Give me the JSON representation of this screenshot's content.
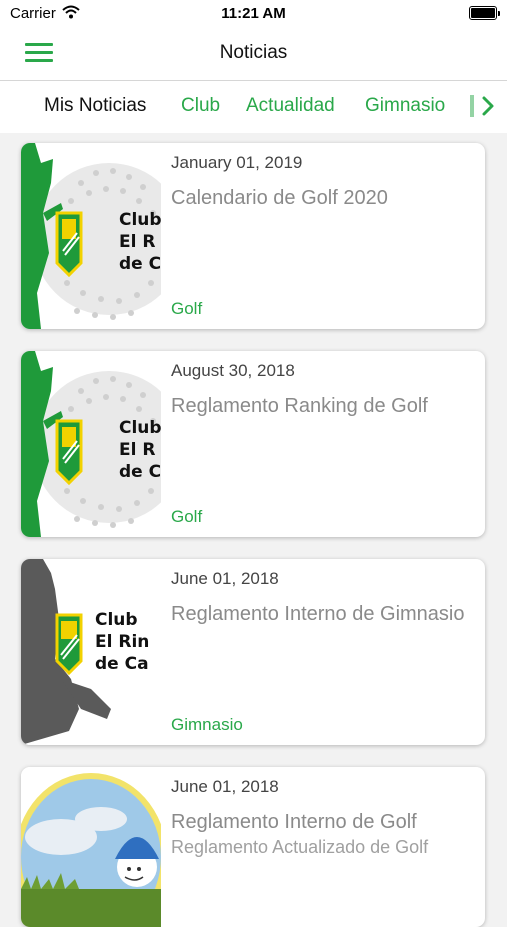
{
  "status_bar": {
    "carrier": "Carrier",
    "time": "11:21 AM"
  },
  "navbar": {
    "title": "Noticias"
  },
  "tabs": [
    {
      "label": "Mis Noticias",
      "active": true
    },
    {
      "label": "Club",
      "active": false
    },
    {
      "label": "Actualidad",
      "active": false
    },
    {
      "label": "Gimnasio",
      "active": false
    }
  ],
  "logo": {
    "line1": "Club",
    "line2": "El R",
    "line3": "de C",
    "line2_alt": "El Rin",
    "line3_alt": "de Ca"
  },
  "news": [
    {
      "date": "January 01, 2019",
      "title": "Calendario de Golf 2020",
      "subtitle": "",
      "category": "Golf"
    },
    {
      "date": "August 30, 2018",
      "title": "Reglamento Ranking de Golf",
      "subtitle": "",
      "category": "Golf"
    },
    {
      "date": "June 01, 2018",
      "title": "Reglamento Interno de Gimnasio",
      "subtitle": "",
      "category": "Gimnasio"
    },
    {
      "date": "June 01, 2018",
      "title": "Reglamento Interno de Golf",
      "subtitle": "Reglamento Actualizado de Golf",
      "category": ""
    }
  ],
  "colors": {
    "accent": "#2aa84a",
    "shield_green": "#1f9a3a",
    "shield_yellow": "#f2d200"
  }
}
